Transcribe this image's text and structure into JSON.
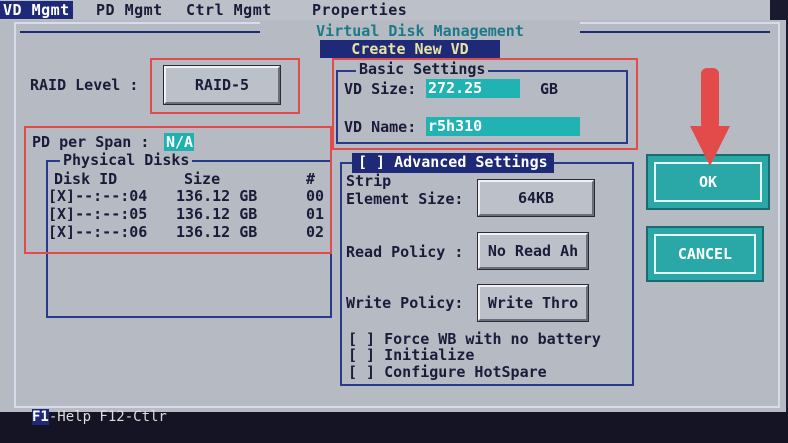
{
  "menu": {
    "vd_mgmt": "VD Mgmt",
    "pd_mgmt": "PD Mgmt",
    "ctrl_mgmt": "Ctrl Mgmt",
    "properties": "Properties"
  },
  "window": {
    "title": "Virtual Disk Management",
    "subtitle": "Create New VD"
  },
  "raid": {
    "label": "RAID Level :",
    "value": "RAID-5"
  },
  "basic": {
    "title": "Basic Settings",
    "size_label": "VD Size:",
    "size_value": "272.25",
    "size_unit": "GB",
    "name_label": "VD Name:",
    "name_value": "r5h310"
  },
  "span": {
    "label": "PD per Span :",
    "value": "N/A"
  },
  "physical": {
    "title": "Physical Disks",
    "headers": [
      "Disk ID",
      "Size",
      "#"
    ],
    "rows": [
      {
        "id": "[X]--:--:04",
        "size": "136.12 GB",
        "num": "00"
      },
      {
        "id": "[X]--:--:05",
        "size": "136.12 GB",
        "num": "01"
      },
      {
        "id": "[X]--:--:06",
        "size": "136.12 GB",
        "num": "02"
      }
    ]
  },
  "advanced": {
    "title": "[ ] Advanced Settings",
    "strip_label1": "Strip",
    "strip_label2": "Element Size:",
    "strip_value": "64KB",
    "read_label": "Read Policy :",
    "read_value": "No Read Ah",
    "write_label": "Write Policy:",
    "write_value": "Write Thro",
    "force_wb": "[ ] Force WB with no battery",
    "initialize": "[ ] Initialize",
    "hotspare": "[ ] Configure HotSpare"
  },
  "buttons": {
    "ok": "OK",
    "cancel": "CANCEL"
  },
  "status": {
    "f1": "F1",
    "rest": "-Help F12-Ctlr"
  },
  "colors": {
    "highlight_red": "#e34b4b",
    "teal": "#2aa8a8",
    "navy": "#1e2a78"
  }
}
